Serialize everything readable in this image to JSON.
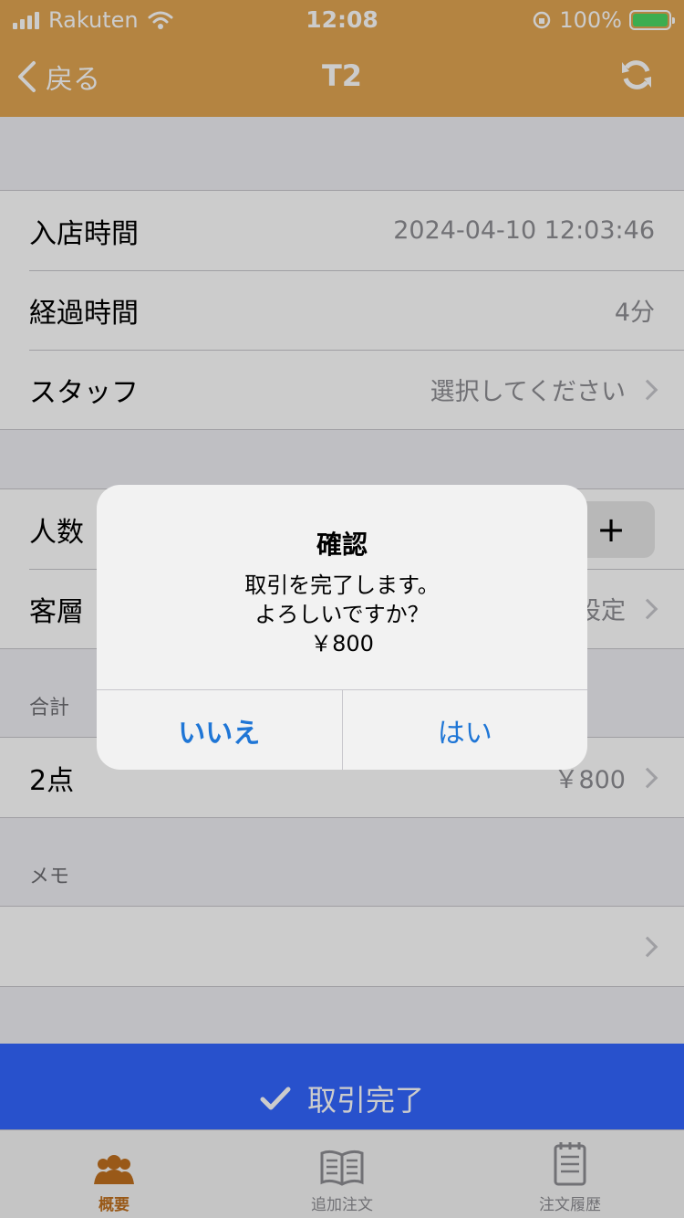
{
  "status_bar": {
    "carrier": "Rakuten",
    "time": "12:08",
    "battery": "100%"
  },
  "nav": {
    "back_label": "戻る",
    "title": "T2"
  },
  "info": [
    {
      "label": "入店時間",
      "value": "2024-04-10 12:03:46"
    },
    {
      "label": "経過時間",
      "value": "4分"
    },
    {
      "label": "スタッフ",
      "value": "選択してください"
    }
  ],
  "people": {
    "label": "人数",
    "plus": "+"
  },
  "customer": {
    "label": "客層",
    "value": "設定"
  },
  "total": {
    "section": "合計",
    "count": "2点",
    "amount": "￥800"
  },
  "memo": {
    "section": "メモ",
    "value": ""
  },
  "complete_button": {
    "label": "取引完了"
  },
  "tabs": [
    {
      "label": "概要",
      "active": true
    },
    {
      "label": "追加注文",
      "active": false
    },
    {
      "label": "注文履歴",
      "active": false
    }
  ],
  "dialog": {
    "title": "確認",
    "line1": "取引を完了します。",
    "line2": "よろしいですか？",
    "line3": "￥800",
    "no": "いいえ",
    "yes": "はい"
  },
  "colors": {
    "nav": "#e1a552",
    "complete": "#3366ff",
    "link": "#1f76d6",
    "tab_active": "#c0701f"
  }
}
